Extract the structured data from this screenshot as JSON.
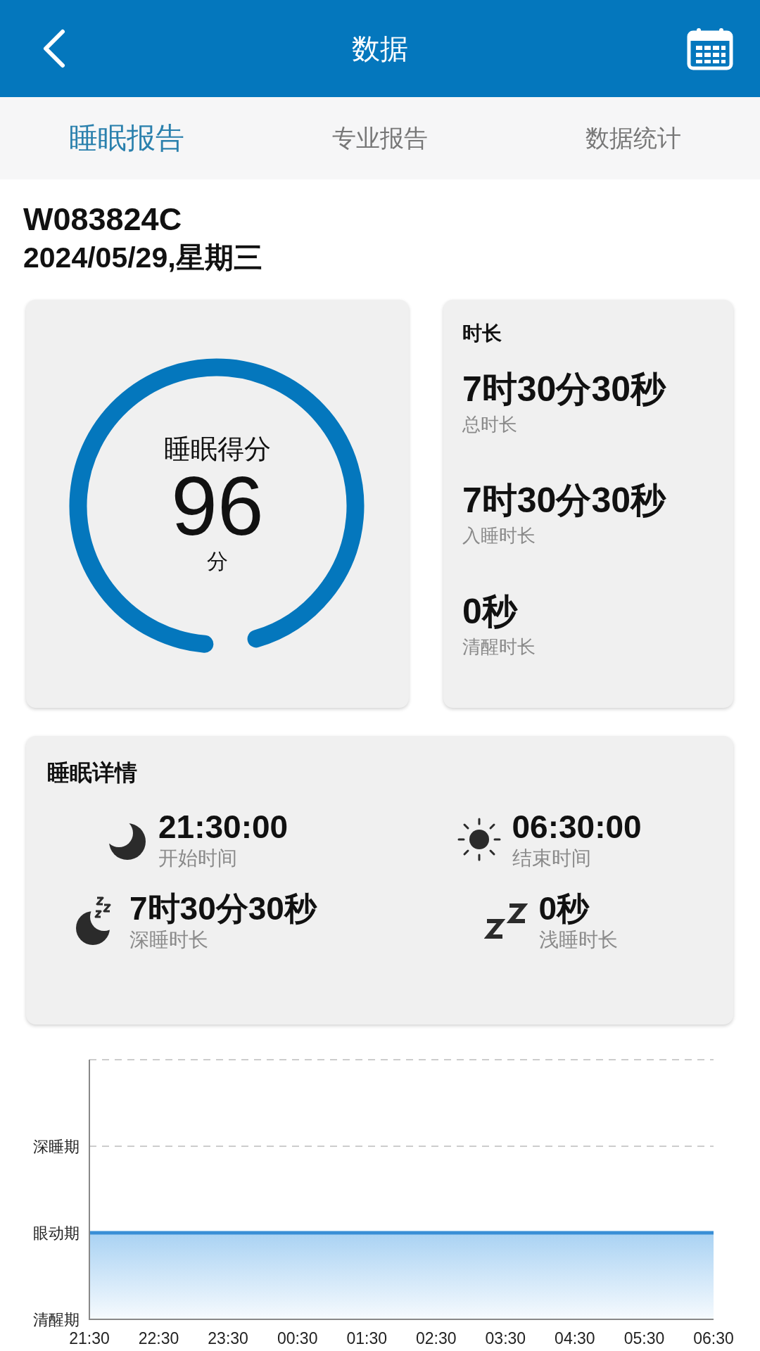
{
  "header": {
    "title": "数据"
  },
  "tabs": [
    {
      "label": "睡眠报告",
      "selected": true
    },
    {
      "label": "专业报告",
      "selected": false
    },
    {
      "label": "数据统计",
      "selected": false
    }
  ],
  "device_id": "W083824C",
  "date": "2024/05/29,星期三",
  "score_card": {
    "label": "睡眠得分",
    "score": "96",
    "unit": "分",
    "level": 0.96
  },
  "duration_card": {
    "title": "时长",
    "items": [
      {
        "value": "7时30分30秒",
        "label": "总时长"
      },
      {
        "value": "7时30分30秒",
        "label": "入睡时长"
      },
      {
        "value": "0秒",
        "label": "清醒时长"
      }
    ]
  },
  "details_card": {
    "title": "睡眠详情",
    "items": [
      {
        "kind": "moon",
        "value": "21:30:00",
        "label": "开始时间"
      },
      {
        "kind": "sun",
        "value": "06:30:00",
        "label": "结束时间"
      },
      {
        "kind": "moon-zzz",
        "value": "7时30分30秒",
        "label": "深睡时长"
      },
      {
        "kind": "zz",
        "value": "0秒",
        "label": "浅睡时长"
      }
    ]
  },
  "sleep_chart": {
    "time_labels": [
      "21:30",
      "22:30",
      "23:30",
      "00:30",
      "01:30",
      "02:30",
      "03:30",
      "04:30",
      "05:30",
      "06:30"
    ],
    "stage_labels": [
      "深睡期",
      "眼动期",
      "清醒期"
    ]
  }
}
